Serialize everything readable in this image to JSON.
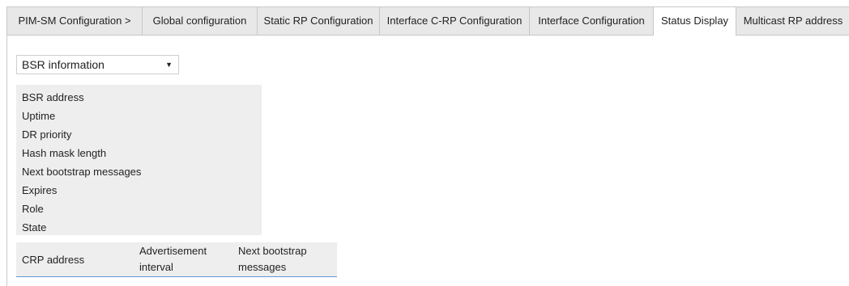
{
  "tabs": [
    {
      "label": "PIM-SM Configuration  >"
    },
    {
      "label": "Global configuration"
    },
    {
      "label": "Static RP Configuration"
    },
    {
      "label": "Interface C-RP Configuration"
    },
    {
      "label": "Interface Configuration"
    },
    {
      "label": "Status Display"
    },
    {
      "label": "Multicast RP address"
    }
  ],
  "active_tab": "Status Display",
  "view_select": {
    "selected": "BSR information",
    "arrow": "▼"
  },
  "bsr_fields": [
    {
      "label": "BSR address"
    },
    {
      "label": "Uptime"
    },
    {
      "label": "DR priority"
    },
    {
      "label": "Hash mask length"
    },
    {
      "label": "Next bootstrap messages"
    },
    {
      "label": "Expires"
    },
    {
      "label": "Role"
    },
    {
      "label": "State"
    }
  ],
  "crp_table": {
    "columns": [
      {
        "line1": "CRP address",
        "line2": ""
      },
      {
        "line1": "Advertisement",
        "line2": "interval"
      },
      {
        "line1": "Next bootstrap",
        "line2": "messages"
      }
    ]
  },
  "colors": {
    "tabbar_bg": "#e8e8e8",
    "panel_bg": "#eeeeee",
    "accent_underline": "#5b9bd5"
  }
}
